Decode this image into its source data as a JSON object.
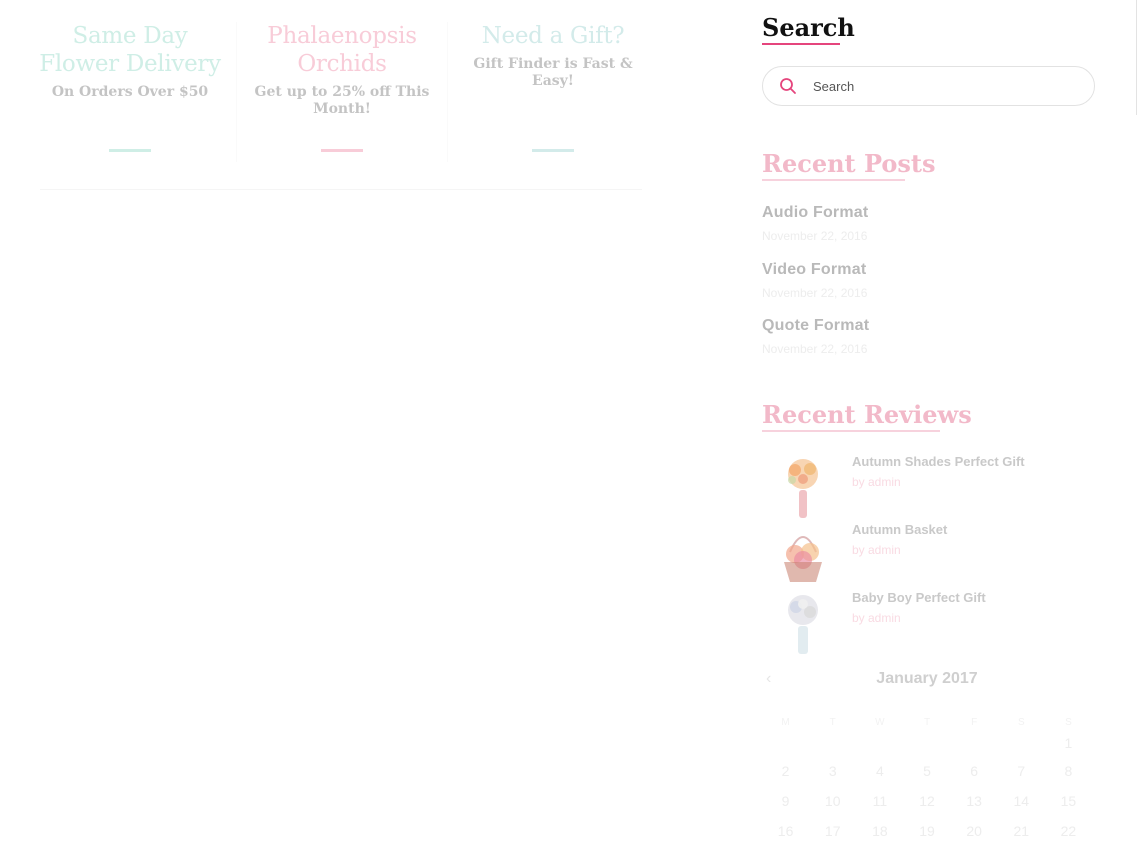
{
  "promos": [
    {
      "title": "Same Day Flower Delivery",
      "subtitle": "On Orders Over $50",
      "color": "#cfeee6"
    },
    {
      "title": "Phalaenopsis Orchids",
      "subtitle": "Get up to 25% off This Month!",
      "color": "#f8ccd8"
    },
    {
      "title": "Need a Gift?",
      "subtitle": "Gift Finder is Fast & Easy!",
      "color": "#d3ebea"
    }
  ],
  "search": {
    "title": "Search",
    "placeholder": "Search"
  },
  "recent_posts": {
    "title": "Recent Posts",
    "items": [
      {
        "title": "Audio Format",
        "date": "November 22, 2016"
      },
      {
        "title": "Video Format",
        "date": "November 22, 2016"
      },
      {
        "title": "Quote Format",
        "date": "November 22, 2016"
      }
    ]
  },
  "recent_reviews": {
    "title": "Recent Reviews",
    "items": [
      {
        "title": "Autumn Shades Perfect Gift",
        "by": "by admin"
      },
      {
        "title": "Autumn Basket",
        "by": "by admin"
      },
      {
        "title": "Baby Boy Perfect Gift",
        "by": "by admin"
      }
    ]
  },
  "calendar": {
    "caption": "January 2017",
    "prev": "‹",
    "weekdays": [
      "M",
      "T",
      "W",
      "T",
      "F",
      "S",
      "S"
    ],
    "weeks": [
      [
        "",
        "",
        "",
        "",
        "",
        "",
        "1"
      ],
      [
        "2",
        "3",
        "4",
        "5",
        "6",
        "7",
        "8"
      ],
      [
        "9",
        "10",
        "11",
        "12",
        "13",
        "14",
        "15"
      ],
      [
        "16",
        "17",
        "18",
        "19",
        "20",
        "21",
        "22"
      ]
    ]
  },
  "colors": {
    "accent": "#e5457d",
    "title_dark": "#111111",
    "title_faded": "#f2b9c9"
  }
}
